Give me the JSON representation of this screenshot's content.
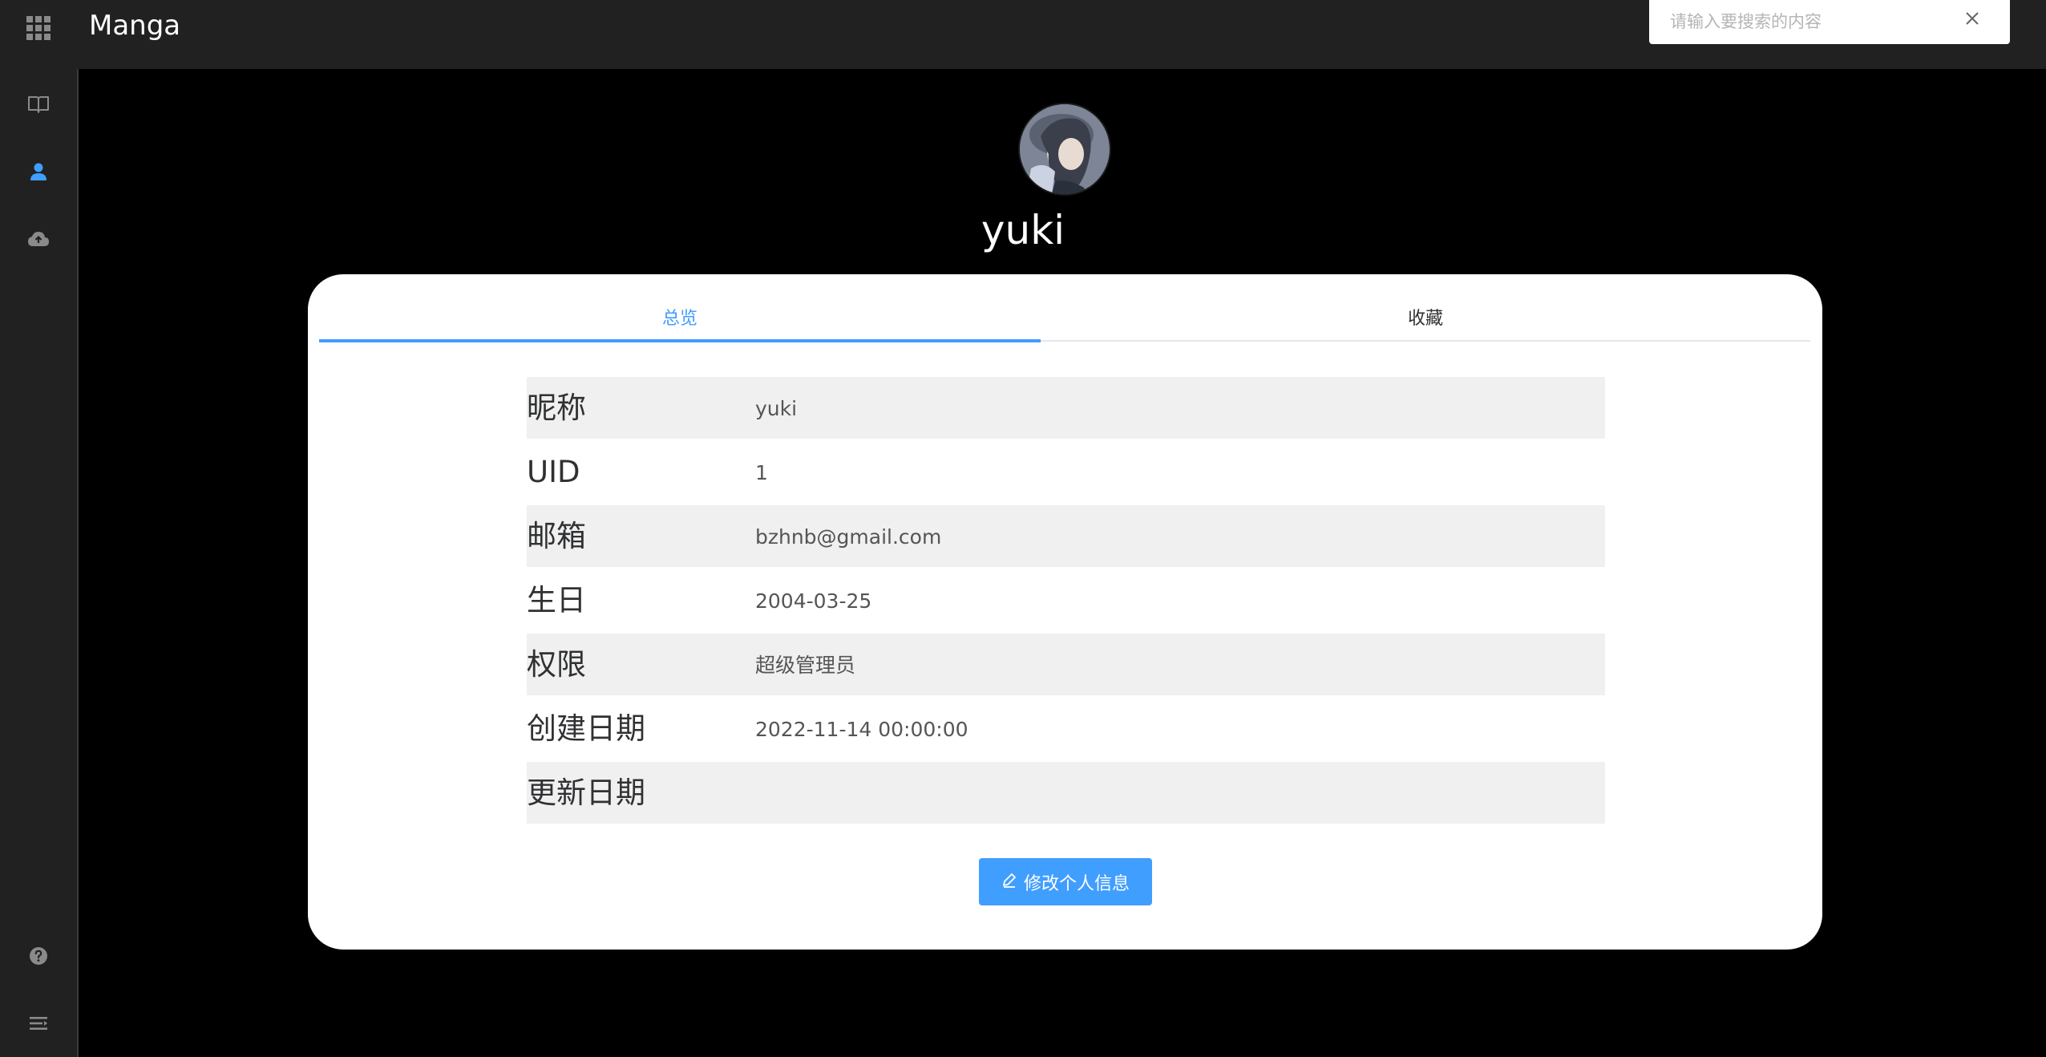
{
  "app": {
    "title": "Manga"
  },
  "search": {
    "placeholder": "请输入要搜索的内容"
  },
  "sidebar": {
    "items": [
      {
        "icon": "book-icon"
      },
      {
        "icon": "user-icon",
        "active": true
      },
      {
        "icon": "cloud-upload-icon"
      },
      {
        "icon": "help-icon"
      },
      {
        "icon": "menu-icon"
      }
    ]
  },
  "profile": {
    "username": "yuki"
  },
  "tabs": [
    {
      "label": "总览",
      "active": true
    },
    {
      "label": "收藏",
      "active": false
    }
  ],
  "info": [
    {
      "label": "昵称",
      "value": "yuki"
    },
    {
      "label": "UID",
      "value": "1"
    },
    {
      "label": "邮箱",
      "value": "bzhnb@gmail.com"
    },
    {
      "label": "生日",
      "value": "2004-03-25"
    },
    {
      "label": "权限",
      "value": "超级管理员"
    },
    {
      "label": "创建日期",
      "value": "2022-11-14 00:00:00"
    },
    {
      "label": "更新日期",
      "value": ""
    }
  ],
  "actions": {
    "edit_label": "修改个人信息"
  },
  "colors": {
    "accent": "#409eff",
    "topbar": "#212121",
    "background": "#000000"
  }
}
